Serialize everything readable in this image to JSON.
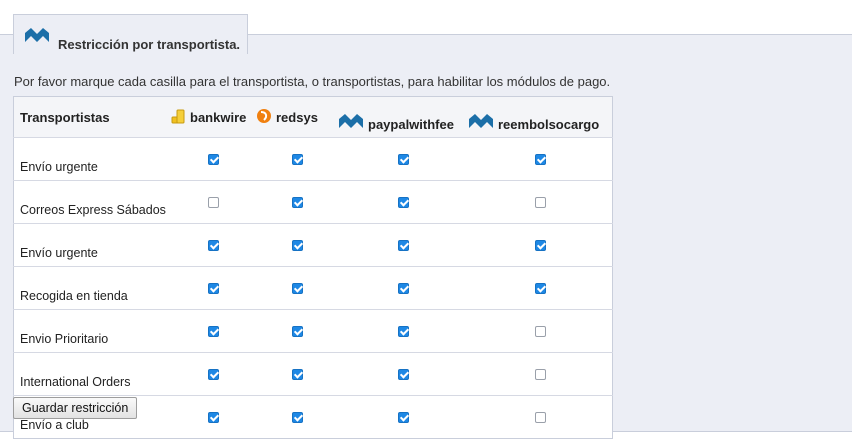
{
  "section": {
    "title": "Restricción por transportista.",
    "intro": "Por favor marque cada casilla para el transportista, o transportistas, para habilitar los módulos de pago."
  },
  "table": {
    "header_label": "Transportistas",
    "modules": [
      {
        "name": "bankwire",
        "icon": "coins-icon",
        "color": "#f0c020"
      },
      {
        "name": "redsys",
        "icon": "redsys-icon",
        "color": "#f08010"
      },
      {
        "name": "paypalwithfee",
        "icon": "prestashop-logo-icon",
        "color": "#1c6fa8"
      },
      {
        "name": "reembolsocargo",
        "icon": "prestashop-logo-icon",
        "color": "#1c6fa8"
      }
    ],
    "rows": [
      {
        "carrier": "Envío urgente",
        "checked": [
          true,
          true,
          true,
          true
        ]
      },
      {
        "carrier": "Correos Express Sábados",
        "checked": [
          false,
          true,
          true,
          false
        ]
      },
      {
        "carrier": "Envío urgente",
        "checked": [
          true,
          true,
          true,
          true
        ]
      },
      {
        "carrier": "Recogida en tienda",
        "checked": [
          true,
          true,
          true,
          true
        ]
      },
      {
        "carrier": "Envio Prioritario",
        "checked": [
          true,
          true,
          true,
          false
        ]
      },
      {
        "carrier": "International Orders",
        "checked": [
          true,
          true,
          true,
          false
        ]
      },
      {
        "carrier": "Envío a club",
        "checked": [
          true,
          true,
          true,
          false
        ]
      }
    ]
  },
  "save_button": "Guardar restricción"
}
